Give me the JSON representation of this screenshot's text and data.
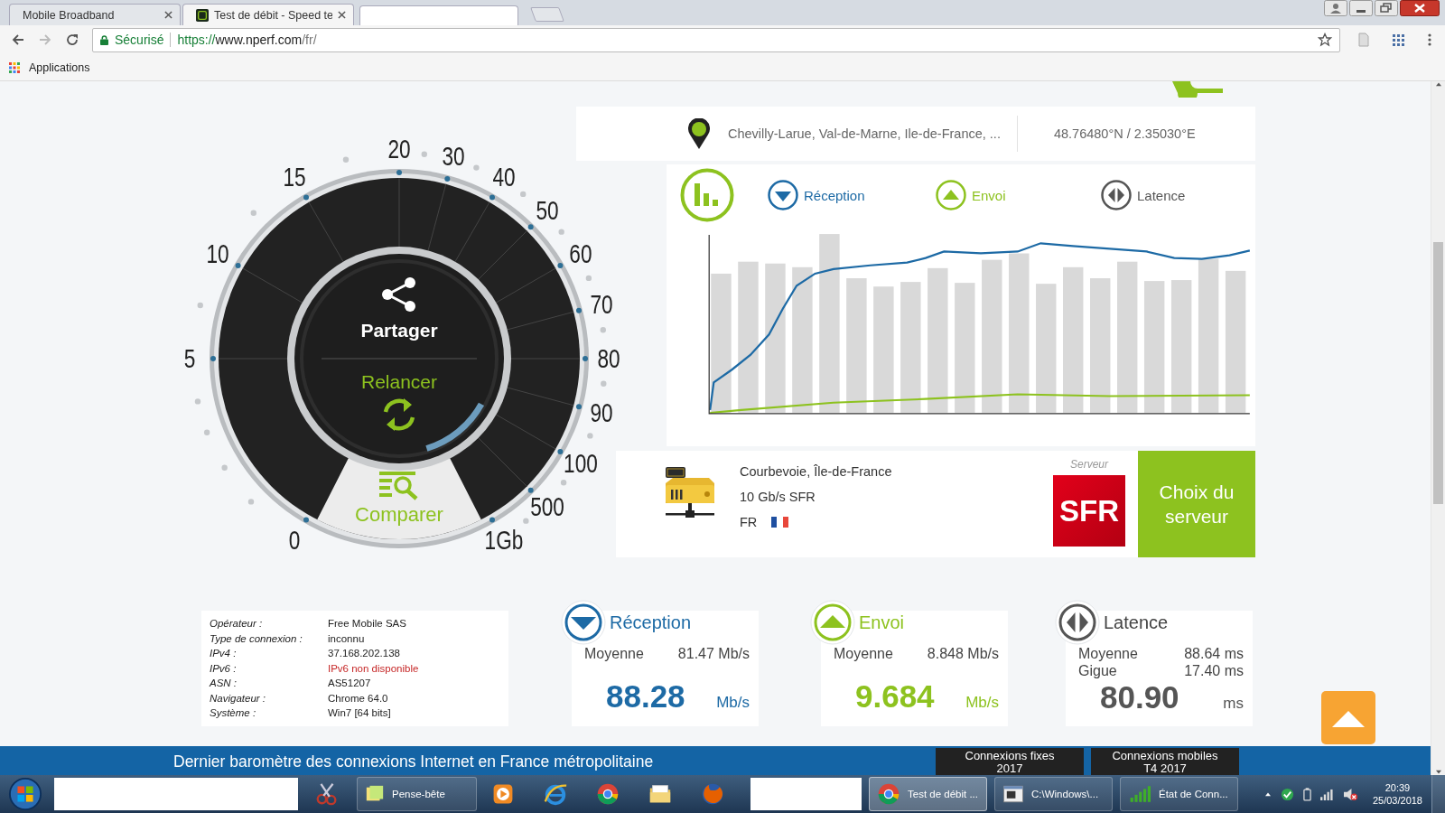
{
  "browser": {
    "tabs": [
      {
        "title": "Mobile Broadband",
        "selected": false
      },
      {
        "title": "Test de débit - Speed te",
        "selected": true
      },
      {
        "selected": false
      }
    ],
    "address": {
      "secure_label": "Sécurisé",
      "scheme": "https://",
      "host": "www.nperf.com",
      "path": "/fr/"
    },
    "bookmarks": [
      {
        "label": "Applications"
      }
    ]
  },
  "location": {
    "place": "Chevilly-Larue, Val-de-Marne, Ile-de-France, ...",
    "coordinates": "48.76480°N / 2.35030°E"
  },
  "gauge": {
    "scale": [
      "0",
      "5",
      "10",
      "15",
      "20",
      "30",
      "40",
      "50",
      "60",
      "70",
      "80",
      "90",
      "100",
      "500",
      "1Gb"
    ],
    "share": "Partager",
    "restart": "Relancer",
    "compare": "Comparer"
  },
  "legend": [
    {
      "kind": "download",
      "label": "Réception"
    },
    {
      "kind": "upload",
      "label": "Envoi"
    },
    {
      "kind": "latency",
      "label": "Latence"
    }
  ],
  "server": {
    "city": "Courbevoie, Île-de-France",
    "link": "10 Gb/s SFR",
    "country": "FR",
    "caption": "Serveur",
    "provider_logo": "SFR",
    "choose_button": "Choix du serveur"
  },
  "connection_info": [
    {
      "label": "Opérateur :",
      "value": "Free Mobile SAS",
      "error": false
    },
    {
      "label": "Type de connexion :",
      "value": "inconnu",
      "error": false
    },
    {
      "label": "IPv4 :",
      "value": "37.168.202.138",
      "error": false
    },
    {
      "label": "IPv6 :",
      "value": "IPv6 non disponible",
      "error": true
    },
    {
      "label": "ASN :",
      "value": "AS51207",
      "error": false
    },
    {
      "label": "Navigateur :",
      "value": "Chrome 64.0",
      "error": false
    },
    {
      "label": "Système :",
      "value": "Win7 [64 bits]",
      "error": false
    }
  ],
  "results": [
    {
      "kind": "download",
      "title": "Réception",
      "rows": [
        {
          "label": "Moyenne",
          "value": "81.47 Mb/s"
        }
      ],
      "value": "88.28",
      "unit": "Mb/s"
    },
    {
      "kind": "upload",
      "title": "Envoi",
      "rows": [
        {
          "label": "Moyenne",
          "value": "8.848 Mb/s"
        }
      ],
      "value": "9.684",
      "unit": "Mb/s"
    },
    {
      "kind": "latency",
      "title": "Latence",
      "rows": [
        {
          "label": "Moyenne",
          "value": "88.64 ms"
        },
        {
          "label": "Gigue",
          "value": "17.40 ms"
        }
      ],
      "value": "80.90",
      "unit": "ms"
    }
  ],
  "banner": {
    "text": "Dernier baromètre des connexions Internet en France métropolitaine",
    "tabs": [
      {
        "title": "Connexions fixes",
        "subtitle": "2017"
      },
      {
        "title": "Connexions mobiles",
        "subtitle": "T4 2017"
      }
    ]
  },
  "taskbar": {
    "items": [
      {
        "kind": "start",
        "selected": false
      },
      {
        "kind": "blank-wide",
        "selected": false
      },
      {
        "kind": "snip",
        "selected": false
      },
      {
        "kind": "notes",
        "label": "Pense-bête",
        "selected": false
      },
      {
        "kind": "media",
        "selected": false
      },
      {
        "kind": "ie",
        "selected": false
      },
      {
        "kind": "chrome",
        "selected": false
      },
      {
        "kind": "folder",
        "selected": false
      },
      {
        "kind": "firefox",
        "selected": false
      },
      {
        "kind": "blank",
        "selected": false
      },
      {
        "kind": "chrome-window",
        "label": "Test de débit ...",
        "selected": true
      },
      {
        "kind": "cmd-window",
        "label": "C:\\Windows\\...",
        "selected": false
      },
      {
        "kind": "network-window",
        "label": "État de Conn...",
        "selected": false
      }
    ],
    "time": "20:39",
    "date": "25/03/2018"
  }
}
